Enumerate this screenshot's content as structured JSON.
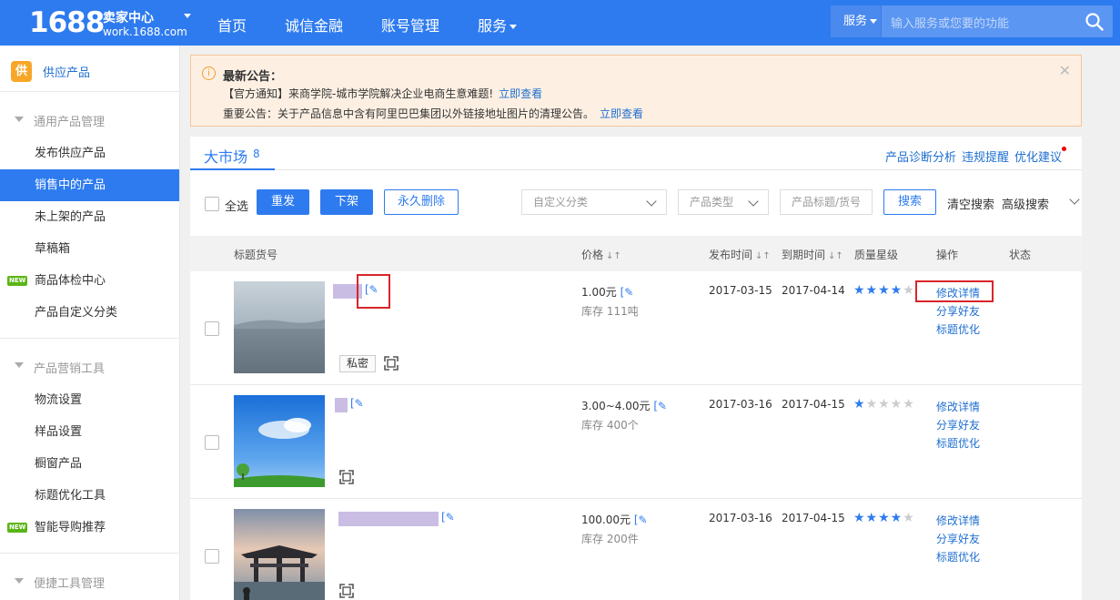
{
  "topbar": {
    "logo_number": "1688",
    "logo_title": "卖家中心",
    "logo_domain": "work.1688.com",
    "nav": [
      "首页",
      "诚信金融",
      "账号管理",
      "服务"
    ],
    "search_category": "服务",
    "search_placeholder": "输入服务或您要的功能"
  },
  "sidebar": {
    "logo_char": "供",
    "title": "供应产品",
    "new_badge": "NEW",
    "groups": [
      {
        "label": "通用产品管理",
        "items": [
          "发布供应产品",
          "销售中的产品",
          "未上架的产品",
          "草稿箱",
          "商品体检中心",
          "产品自定义分类"
        ]
      },
      {
        "label": "产品营销工具",
        "items": [
          "物流设置",
          "样品设置",
          "橱窗产品",
          "标题优化工具",
          "智能导购推荐"
        ]
      },
      {
        "label": "便捷工具管理",
        "items": []
      }
    ]
  },
  "notice": {
    "title": "最新公告：",
    "line1": "【官方通知】来商学院-城市学院解决企业电商生意难题!",
    "line1_link": "立即查看",
    "line2": "重要公告：关于产品信息中含有阿里巴巴集团以外链接地址图片的清理公告。",
    "line2_link": "立即查看"
  },
  "panel": {
    "tab_label": "大市场",
    "tab_count": "8",
    "links": [
      "产品诊断分析",
      "违规提醒",
      "优化建议"
    ],
    "select_all": "全选",
    "btn_republish": "重发",
    "btn_offline": "下架",
    "btn_delete": "永久删除",
    "custom_category": "自定义分类",
    "product_type": "产品类型",
    "keyword_placeholder": "产品标题/货号",
    "btn_search": "搜索",
    "clear_search": "清空搜索",
    "advanced_search": "高级搜索",
    "columns": {
      "title": "标题货号",
      "price": "价格",
      "publish": "发布时间",
      "expire": "到期时间",
      "quality": "质量星级",
      "ops": "操作",
      "status": "状态"
    },
    "rows": [
      {
        "price": "1.00元",
        "stock": "库存 111吨",
        "publish": "2017-03-15",
        "expire": "2017-04-14",
        "stars": 4,
        "tag": "私密",
        "op1": "修改详情",
        "op2": "分享好友",
        "op3": "标题优化"
      },
      {
        "price": "3.00~4.00元",
        "stock": "库存 400个",
        "publish": "2017-03-16",
        "expire": "2017-04-15",
        "stars": 1,
        "op1": "修改详情",
        "op2": "分享好友",
        "op3": "标题优化"
      },
      {
        "price": "100.00元",
        "stock": "库存 200件",
        "publish": "2017-03-16",
        "expire": "2017-04-15",
        "stars": 4,
        "op1": "修改详情",
        "op2": "分享好友",
        "op3": "标题优化"
      }
    ]
  },
  "colors": {
    "brand_blue": "#2e7bef",
    "link_blue": "#1f6fd0",
    "highlight_red": "#d9252a"
  }
}
